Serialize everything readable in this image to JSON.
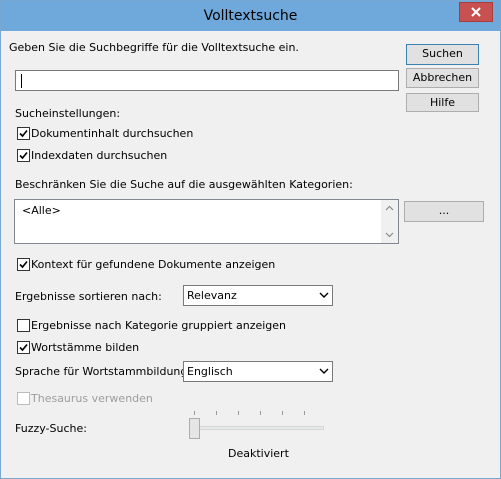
{
  "window": {
    "title": "Volltextsuche"
  },
  "prompt": "Geben Sie die Suchbegriffe für die Volltextsuche ein.",
  "search_input": {
    "value": "",
    "placeholder": ""
  },
  "buttons": {
    "search": "Suchen",
    "cancel": "Abbrechen",
    "help": "Hilfe",
    "browse_categories": "..."
  },
  "settings_heading": "Sucheinstellungen:",
  "options": {
    "search_content": {
      "label": "Dokumentinhalt durchsuchen",
      "checked": true
    },
    "search_index": {
      "label": "Indexdaten durchsuchen",
      "checked": true
    }
  },
  "categories": {
    "label": "Beschränken Sie die Suche auf die ausgewählten Kategorien:",
    "items": [
      "<Alle>"
    ]
  },
  "show_context": {
    "label": "Kontext für gefundene Dokumente anzeigen",
    "checked": true
  },
  "sort": {
    "label": "Ergebnisse sortieren nach:",
    "value": "Relevanz"
  },
  "group_by_category": {
    "label": "Ergebnisse nach Kategorie gruppiert anzeigen",
    "checked": false
  },
  "stemming": {
    "label": "Wortstämme bilden",
    "checked": true
  },
  "stemming_language": {
    "label": "Sprache für Wortstammbildung:",
    "value": "Englisch"
  },
  "thesaurus": {
    "label": "Thesaurus verwenden",
    "checked": false,
    "enabled": false
  },
  "fuzzy": {
    "label": "Fuzzy-Suche:",
    "level": 0,
    "status": "Deaktiviert"
  },
  "colors": {
    "titlebar": "#6fa9dc",
    "close_button": "#c75050",
    "dialog_bg": "#f0f0f0"
  }
}
